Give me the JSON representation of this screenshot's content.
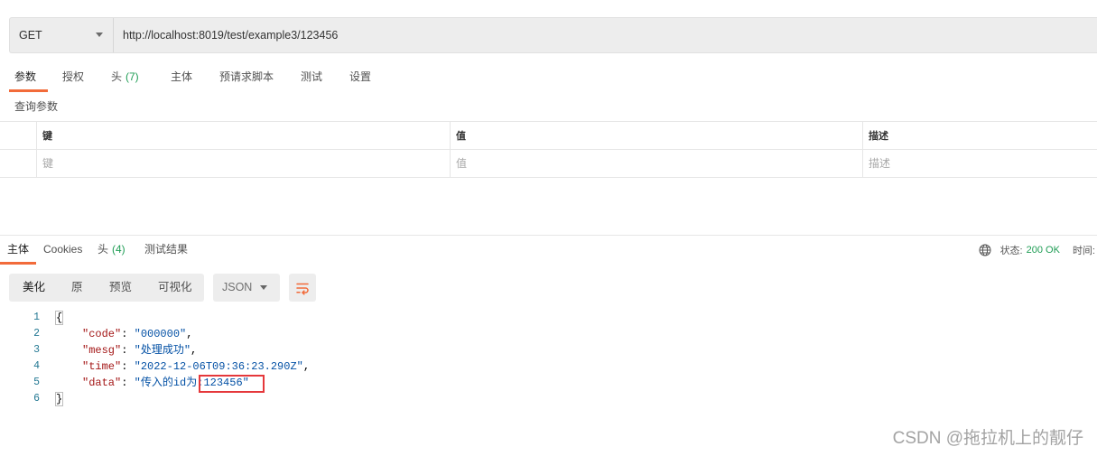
{
  "request": {
    "method": "GET",
    "url": "http://localhost:8019/test/example3/123456",
    "tabs": [
      {
        "label": "参数",
        "active": true
      },
      {
        "label": "授权"
      },
      {
        "label": "头",
        "count": "(7)"
      },
      {
        "label": "主体"
      },
      {
        "label": "预请求脚本"
      },
      {
        "label": "测试"
      },
      {
        "label": "设置"
      }
    ]
  },
  "params": {
    "title": "查询参数",
    "columns": {
      "key": "键",
      "value": "值",
      "description": "描述"
    },
    "placeholder": {
      "key": "键",
      "value": "值",
      "description": "描述"
    }
  },
  "response": {
    "tabs": [
      {
        "label": "主体",
        "active": true
      },
      {
        "label": "Cookies"
      },
      {
        "label": "头",
        "count": "(4)"
      },
      {
        "label": "测试结果"
      }
    ],
    "status_label": "状态:",
    "status_value": "200 OK",
    "time_label": "时间:",
    "view_modes": [
      {
        "label": "美化",
        "active": true
      },
      {
        "label": "原"
      },
      {
        "label": "预览"
      },
      {
        "label": "可视化"
      }
    ],
    "format": "JSON",
    "body": {
      "lines": [
        {
          "num": "1",
          "text": "{"
        },
        {
          "num": "2",
          "key": "\"code\"",
          "sep": ": ",
          "value": "\"000000\"",
          "trail": ","
        },
        {
          "num": "3",
          "key": "\"mesg\"",
          "sep": ": ",
          "value": "\"处理成功\"",
          "trail": ","
        },
        {
          "num": "4",
          "key": "\"time\"",
          "sep": ": ",
          "value": "\"2022-12-06T09:36:23.290Z\"",
          "trail": ","
        },
        {
          "num": "5",
          "key": "\"data\"",
          "sep": ": ",
          "value": "\"传入的id为:",
          "value_boxed": "123456\""
        },
        {
          "num": "6",
          "text": "}"
        }
      ]
    }
  },
  "watermark": "CSDN @拖拉机上的靓仔",
  "icons": {
    "method_dropdown": "chevron-down-icon",
    "globe": "globe-icon",
    "format_dropdown": "caret-down-icon",
    "wrap": "wrap-lines-icon"
  },
  "colors": {
    "accent": "#f26b3a",
    "success": "#1f9d55",
    "json_key": "#a31515",
    "json_value": "#0451a5",
    "line_number": "#237893",
    "annotation": "#e5383b"
  }
}
